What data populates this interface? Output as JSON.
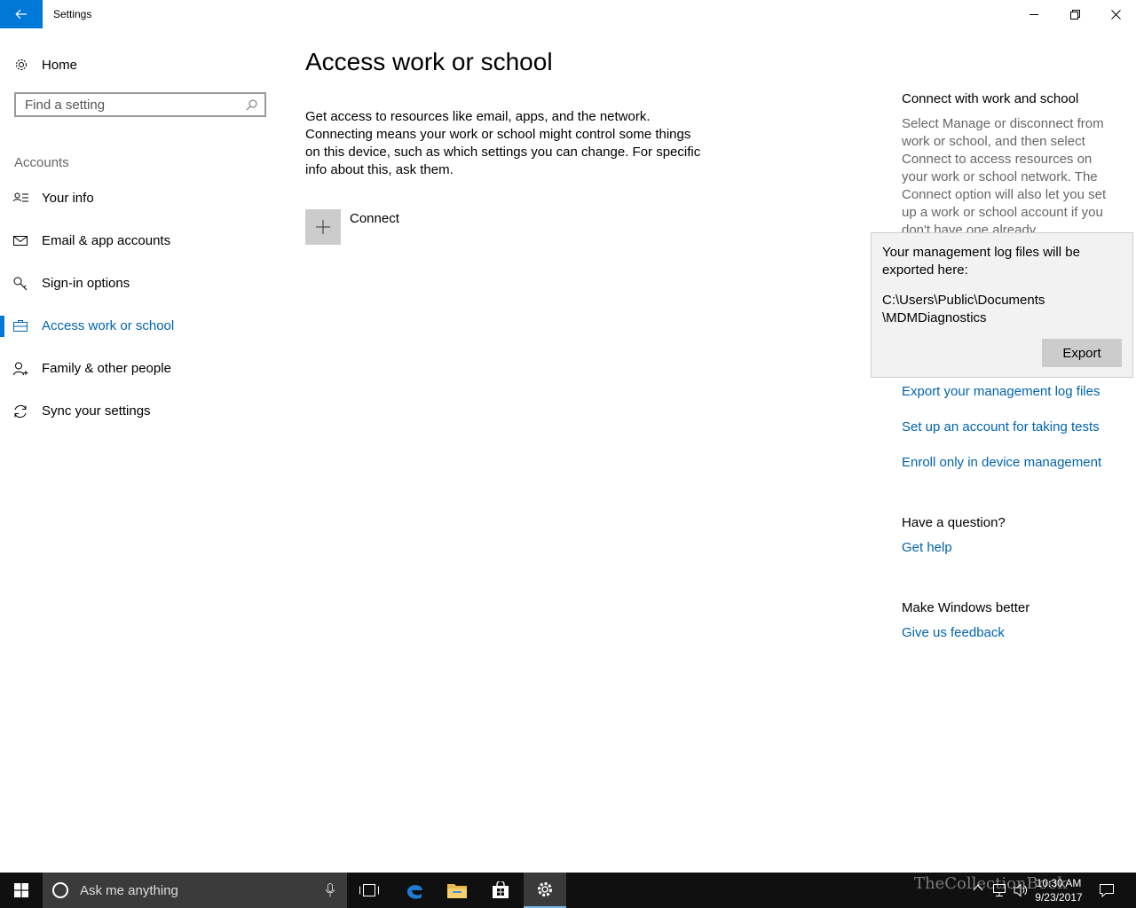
{
  "window": {
    "title": "Settings",
    "controls": [
      "minimize",
      "restore",
      "close"
    ]
  },
  "sidebar": {
    "home_label": "Home",
    "search_placeholder": "Find a setting",
    "section_header": "Accounts",
    "items": [
      {
        "label": "Your info",
        "icon": "person-card-icon",
        "active": false
      },
      {
        "label": "Email & app accounts",
        "icon": "mail-icon",
        "active": false
      },
      {
        "label": "Sign-in options",
        "icon": "key-icon",
        "active": false
      },
      {
        "label": "Access work or school",
        "icon": "briefcase-icon",
        "active": true
      },
      {
        "label": "Family & other people",
        "icon": "person-add-icon",
        "active": false
      },
      {
        "label": "Sync your settings",
        "icon": "sync-icon",
        "active": false
      }
    ]
  },
  "main": {
    "title": "Access work or school",
    "description": "Get access to resources like email, apps, and the network. Connecting means your work or school might control some things on this device, such as which settings you can change. For specific info about this, ask them.",
    "connect_label": "Connect"
  },
  "right_column": {
    "connect_heading": "Connect with work and school",
    "connect_text": "Select Manage or disconnect from work or school, and then select Connect to access resources on your work or school network. The Connect option will also let you set up a work or school account if you don't have one already.",
    "links": {
      "export_logs": "Export your management log files",
      "setup_tests": "Set up an account for taking tests",
      "enroll": "Enroll only in device management"
    },
    "question_heading": "Have a question?",
    "get_help": "Get help",
    "better_heading": "Make Windows better",
    "feedback": "Give us feedback"
  },
  "flyout": {
    "message": "Your management log files will be exported here:",
    "path_line1": "C:\\Users\\Public\\Documents",
    "path_line2": "\\MDMDiagnostics",
    "export_label": "Export"
  },
  "taskbar": {
    "search_placeholder": "Ask me anything",
    "time": "10:30 AM",
    "date": "9/23/2017",
    "watermark": "TheCollectionBook",
    "accent_color": "#0078d7"
  }
}
